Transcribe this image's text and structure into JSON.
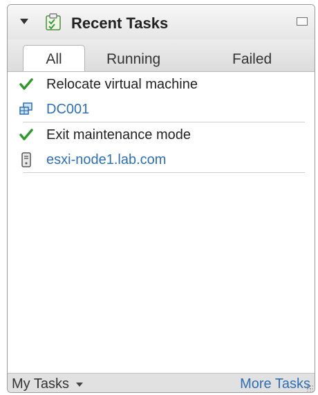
{
  "panel": {
    "title": "Recent Tasks",
    "icons": {
      "collapse": "collapse-arrow-icon",
      "header": "task-clipboard-icon",
      "maximize": "maximize-icon"
    }
  },
  "tabs": [
    {
      "label": "All",
      "active": true
    },
    {
      "label": "Running",
      "active": false
    },
    {
      "label": "Failed",
      "active": false
    }
  ],
  "tasks": [
    {
      "name": "Relocate virtual machine",
      "status_icon": "success-check-icon",
      "target": "DC001",
      "target_icon": "datacenter-icon"
    },
    {
      "name": "Exit maintenance mode",
      "status_icon": "success-check-icon",
      "target": "esxi-node1.lab.com",
      "target_icon": "host-server-icon"
    }
  ],
  "footer": {
    "my_tasks_label": "My Tasks",
    "more_tasks_label": "More Tasks"
  },
  "colors": {
    "link": "#2f6fb1",
    "success": "#2e9a2e",
    "header_bg": "#ececec"
  }
}
